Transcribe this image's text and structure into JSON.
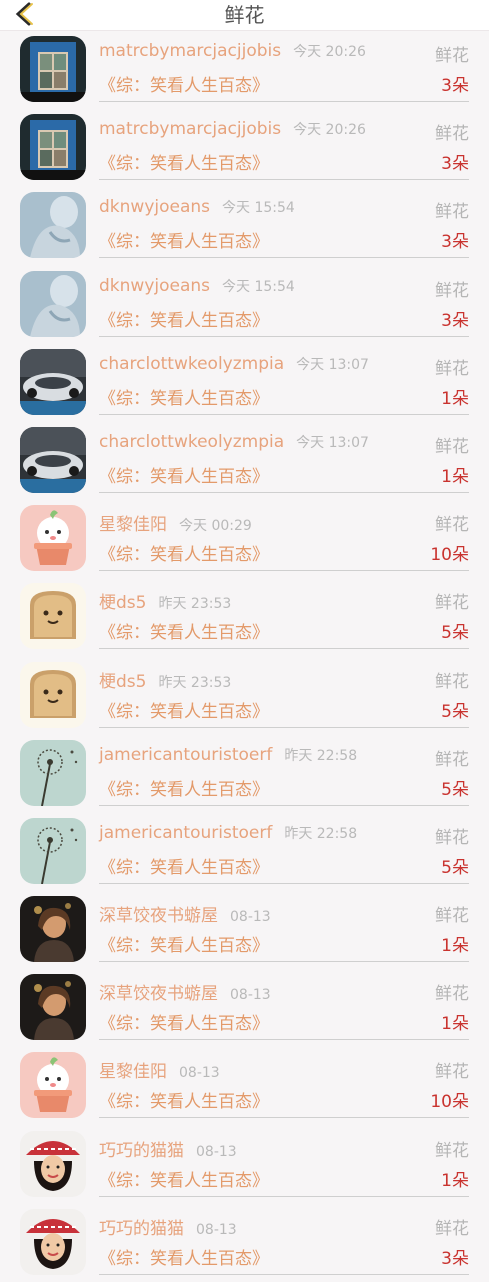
{
  "header": {
    "title": "鲜花",
    "back_icon": "back-chevron-icon"
  },
  "list": [
    {
      "name": "matrcbymarcjacjjobis",
      "time": "今天 20:26",
      "flower_label": "鲜花",
      "book": "《综：笑看人生百态》",
      "count": "3朵",
      "avatar": "window-photo"
    },
    {
      "name": "matrcbymarcjacjjobis",
      "time": "今天 20:26",
      "flower_label": "鲜花",
      "book": "《综：笑看人生百态》",
      "count": "3朵",
      "avatar": "window-photo"
    },
    {
      "name": "dknwyjoeans",
      "time": "今天 15:54",
      "flower_label": "鲜花",
      "book": "《综：笑看人生百态》",
      "count": "3朵",
      "avatar": "portrait-blue"
    },
    {
      "name": "dknwyjoeans",
      "time": "今天 15:54",
      "flower_label": "鲜花",
      "book": "《综：笑看人生百态》",
      "count": "3朵",
      "avatar": "portrait-blue"
    },
    {
      "name": "charclottwkeolyzmpia",
      "time": "今天 13:07",
      "flower_label": "鲜花",
      "book": "《综：笑看人生百态》",
      "count": "1朵",
      "avatar": "car-photo"
    },
    {
      "name": "charclottwkeolyzmpia",
      "time": "今天 13:07",
      "flower_label": "鲜花",
      "book": "《综：笑看人生百态》",
      "count": "1朵",
      "avatar": "car-photo"
    },
    {
      "name": "星黎佳阳",
      "time": "今天 00:29",
      "flower_label": "鲜花",
      "book": "《综：笑看人生百态》",
      "count": "10朵",
      "avatar": "cartoon-pot"
    },
    {
      "name": "梗ds5",
      "time": "昨天 23:53",
      "flower_label": "鲜花",
      "book": "《综：笑看人生百态》",
      "count": "5朵",
      "avatar": "toast"
    },
    {
      "name": "梗ds5",
      "time": "昨天 23:53",
      "flower_label": "鲜花",
      "book": "《综：笑看人生百态》",
      "count": "5朵",
      "avatar": "toast"
    },
    {
      "name": "jamericantouristoerf",
      "time": "昨天 22:58",
      "flower_label": "鲜花",
      "book": "《综：笑看人生百态》",
      "count": "5朵",
      "avatar": "dandelion"
    },
    {
      "name": "jamericantouristoerf",
      "time": "昨天 22:58",
      "flower_label": "鲜花",
      "book": "《综：笑看人生百态》",
      "count": "5朵",
      "avatar": "dandelion"
    },
    {
      "name": "深草饺夜书蝣屋",
      "time": "08-13",
      "flower_label": "鲜花",
      "book": "《综：笑看人生百态》",
      "count": "1朵",
      "avatar": "girl-dark"
    },
    {
      "name": "深草饺夜书蝣屋",
      "time": "08-13",
      "flower_label": "鲜花",
      "book": "《综：笑看人生百态》",
      "count": "1朵",
      "avatar": "girl-dark"
    },
    {
      "name": "星黎佳阳",
      "time": "08-13",
      "flower_label": "鲜花",
      "book": "《综：笑看人生百态》",
      "count": "10朵",
      "avatar": "cartoon-pot"
    },
    {
      "name": "巧巧的猫猫",
      "time": "08-13",
      "flower_label": "鲜花",
      "book": "《综：笑看人生百态》",
      "count": "1朵",
      "avatar": "girl-hat"
    },
    {
      "name": "巧巧的猫猫",
      "time": "08-13",
      "flower_label": "鲜花",
      "book": "《综：笑看人生百态》",
      "count": "3朵",
      "avatar": "girl-hat"
    }
  ]
}
